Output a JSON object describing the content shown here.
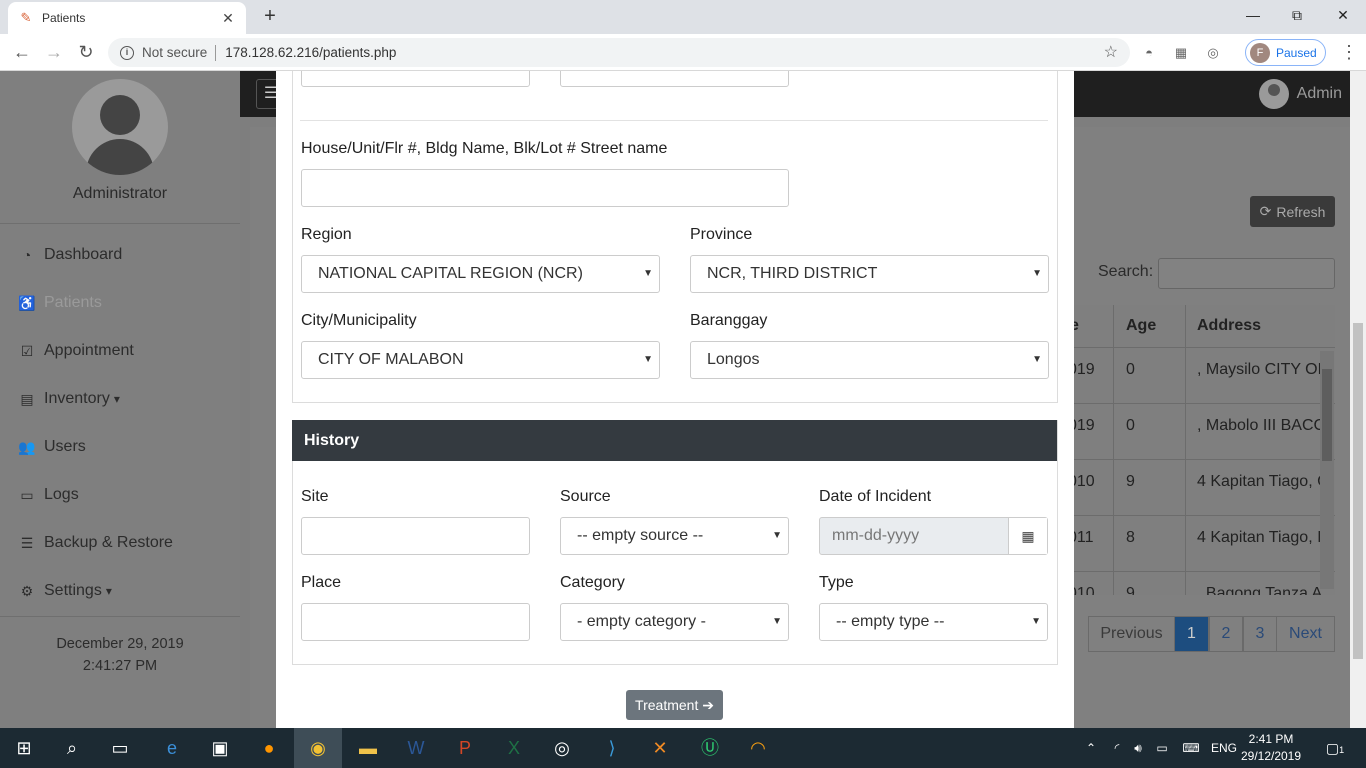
{
  "browser": {
    "tab_title": "Patients",
    "tab_close": "✕",
    "new_tab": "+",
    "not_secure": "Not secure",
    "url": "178.128.62.216/patients.php",
    "profile_initial": "F",
    "profile_status": "Paused",
    "win_min": "—",
    "win_max": "⧉",
    "win_close": "✕"
  },
  "sidebar": {
    "user_name": "Administrator",
    "items": [
      {
        "label": "Dashboard",
        "icon": "tachometer-icon",
        "glyph": "◔"
      },
      {
        "label": "Patients",
        "icon": "wheelchair-icon",
        "glyph": "♿"
      },
      {
        "label": "Appointment",
        "icon": "calendar-check-icon",
        "glyph": "☑"
      },
      {
        "label": "Inventory",
        "icon": "file-icon",
        "glyph": "▤",
        "caret": "▾"
      },
      {
        "label": "Users",
        "icon": "users-icon",
        "glyph": "👥"
      },
      {
        "label": "Logs",
        "icon": "folder-icon",
        "glyph": "▭"
      },
      {
        "label": "Backup & Restore",
        "icon": "database-icon",
        "glyph": "☰"
      },
      {
        "label": "Settings",
        "icon": "cogs-icon",
        "glyph": "⚙",
        "caret": "▾"
      }
    ],
    "date": "December 29, 2019",
    "time": "2:41:27 PM"
  },
  "topbar": {
    "admin_label": "Admin"
  },
  "background_page": {
    "refresh_label": "Refresh",
    "search_label": "Search:",
    "table_headers": [
      "e",
      "Age",
      "Address"
    ],
    "rows": [
      {
        "date": "019",
        "age": "0",
        "address": ", Maysilo CITY OF"
      },
      {
        "date": "019",
        "age": "0",
        "address": ", Mabolo III BACC"
      },
      {
        "date": "010",
        "age": "9",
        "address": "4 Kapitan Tiago, C"
      },
      {
        "date": "011",
        "age": "8",
        "address": "4 Kapitan Tiago, I"
      },
      {
        "date": "010",
        "age": "9",
        "address": ", Bagong Tanza A"
      }
    ],
    "pagination": [
      "Previous",
      "1",
      "2",
      "3",
      "Next"
    ]
  },
  "modal": {
    "address_label": "House/Unit/Flr #, Bldg Name, Blk/Lot # Street name",
    "region_label": "Region",
    "region_value": "NATIONAL CAPITAL REGION (NCR)",
    "province_label": "Province",
    "province_value": "NCR, THIRD DISTRICT",
    "city_label": "City/Municipality",
    "city_value": "CITY OF MALABON",
    "barangay_label": "Baranggay",
    "barangay_value": "Longos",
    "history_title": "History",
    "site_label": "Site",
    "source_label": "Source",
    "source_value": "-- empty source --",
    "date_label": "Date of Incident",
    "date_placeholder": "mm-dd-yyyy",
    "place_label": "Place",
    "category_label": "Category",
    "category_value": "- empty category -",
    "type_label": "Type",
    "type_value": "-- empty type --",
    "treatment_label": "Treatment ➔"
  },
  "taskbar": {
    "language": "ENG",
    "clock_time": "2:41 PM",
    "clock_date": "29/12/2019",
    "notification_count": "1"
  },
  "colors": {
    "history_header": "#343a40",
    "treatment_button": "#6c757d",
    "active_page": "#1d4d7f",
    "topbar": "#1f1f1f"
  }
}
